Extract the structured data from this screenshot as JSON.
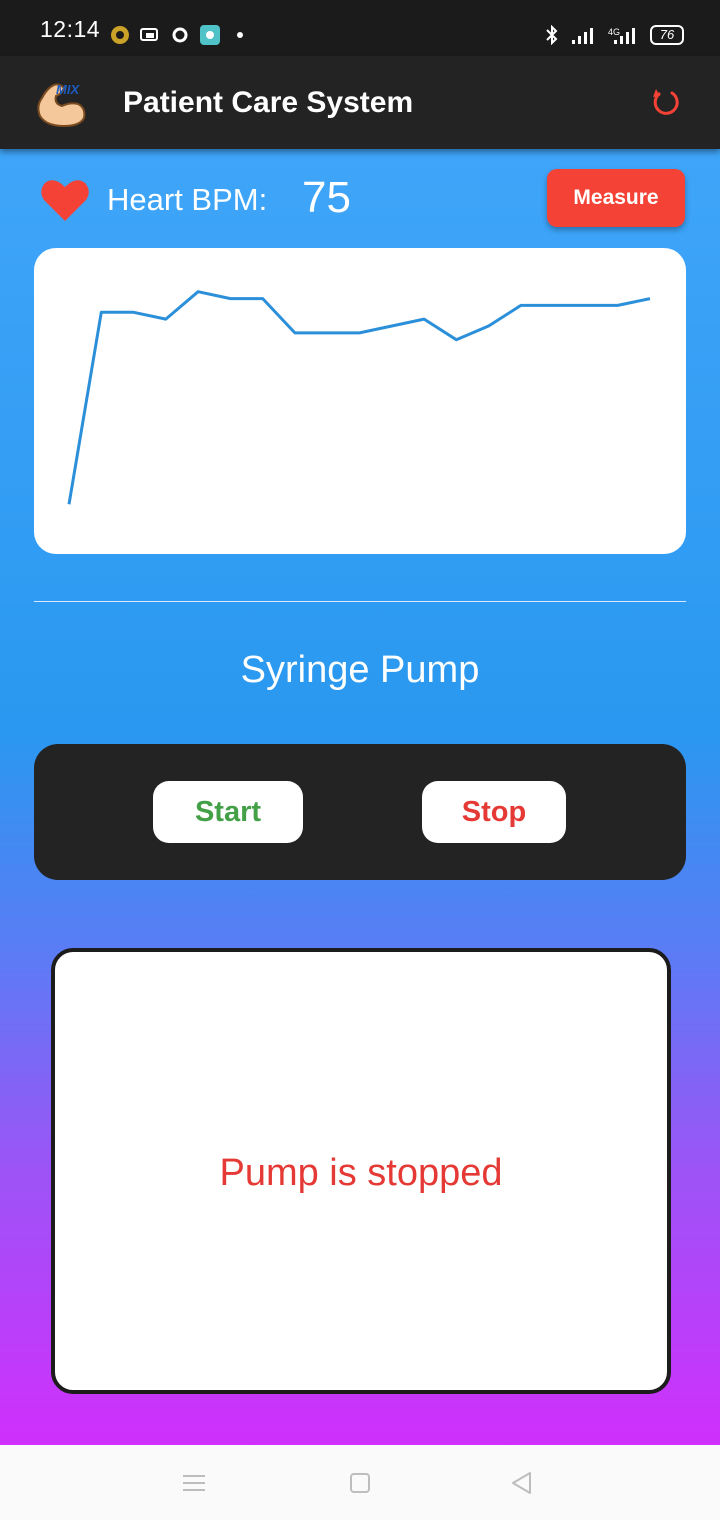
{
  "status_bar": {
    "time": "12:14",
    "battery": "76",
    "network": "4G"
  },
  "app_bar": {
    "title": "Patient Care System",
    "logo_text": "MIX",
    "refresh_icon": "refresh-icon",
    "refresh_color": "#f44336"
  },
  "heart": {
    "label": "Heart BPM:",
    "value": "75",
    "icon": "heart-icon",
    "icon_color": "#f44336"
  },
  "measure_button": {
    "label": "Measure",
    "color": "#f44336"
  },
  "chart_data": {
    "type": "line",
    "title": "",
    "xlabel": "",
    "ylabel": "",
    "grid": false,
    "legend": false,
    "series": [
      {
        "line_color": "#2b8fd9",
        "x": [
          0,
          1,
          2,
          3,
          4,
          5,
          6,
          7,
          8,
          9,
          10,
          11,
          12,
          13,
          14,
          15,
          16,
          17,
          18
        ],
        "values": [
          52,
          80,
          80,
          79,
          83,
          82,
          82,
          77,
          77,
          77,
          78,
          79,
          76,
          78,
          81,
          81,
          81,
          81,
          82
        ]
      }
    ],
    "ylim": [
      50,
      85
    ]
  },
  "pump": {
    "title": "Syringe Pump",
    "start_label": "Start",
    "stop_label": "Stop",
    "start_color": "#43a047",
    "stop_color": "#e53935",
    "status_text": "Pump is stopped"
  },
  "nav": {
    "icons": [
      "menu-icon",
      "home-icon",
      "back-icon"
    ]
  }
}
